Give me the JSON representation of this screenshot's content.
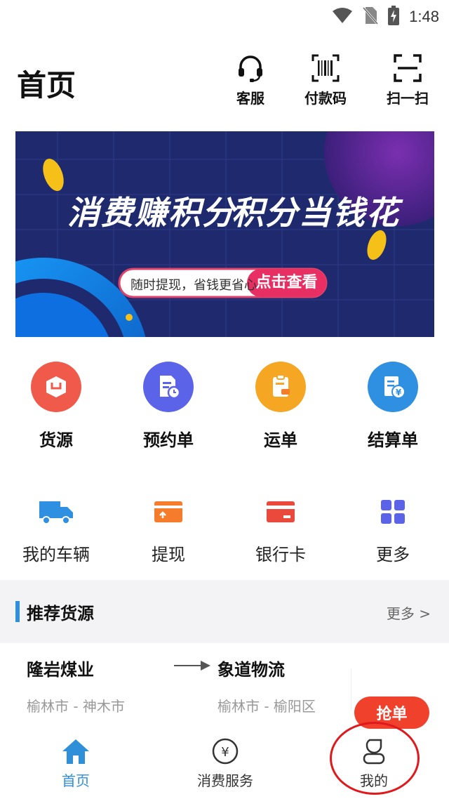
{
  "status_bar": {
    "time": "1:48"
  },
  "header": {
    "title": "首页",
    "actions": [
      {
        "label": "客服",
        "icon": "headset-icon"
      },
      {
        "label": "付款码",
        "icon": "barcode-icon"
      },
      {
        "label": "扫一扫",
        "icon": "scan-icon"
      }
    ]
  },
  "banner": {
    "headline_left": "消费赚积分",
    "headline_right": "积分当钱花",
    "subtext": "随时提现，省钱更省心",
    "cta": "点击查看"
  },
  "quick_actions": [
    {
      "label": "货源",
      "icon": "cargo-box-icon",
      "color": "#ef5a4a"
    },
    {
      "label": "预约单",
      "icon": "document-clock-icon",
      "color": "#5b63e8"
    },
    {
      "label": "运单",
      "icon": "clipboard-truck-icon",
      "color": "#f5a623"
    },
    {
      "label": "结算单",
      "icon": "bill-yuan-icon",
      "color": "#2f8fe0"
    }
  ],
  "tools": [
    {
      "label": "我的车辆",
      "icon": "truck-icon",
      "color": "#2f8fe0"
    },
    {
      "label": "提现",
      "icon": "wallet-icon",
      "color": "#f57c2a"
    },
    {
      "label": "银行卡",
      "icon": "bank-card-icon",
      "color": "#ea4a3c"
    },
    {
      "label": "更多",
      "icon": "grid-icon",
      "color": "#5b63e8"
    }
  ],
  "recommend": {
    "title": "推荐货源",
    "more": "更多 >",
    "item": {
      "from": "隆岩煤业",
      "to": "象道物流",
      "from_city": "榆林市 - 神木市",
      "to_city": "榆林市 - 榆阳区",
      "action": "抢单"
    }
  },
  "tabbar": {
    "tabs": [
      {
        "label": "首页",
        "icon": "home-icon",
        "active": true
      },
      {
        "label": "消费服务",
        "icon": "yuan-icon",
        "active": false
      },
      {
        "label": "我的",
        "icon": "user-icon",
        "active": false
      }
    ],
    "active_color": "#2f8fd8"
  }
}
